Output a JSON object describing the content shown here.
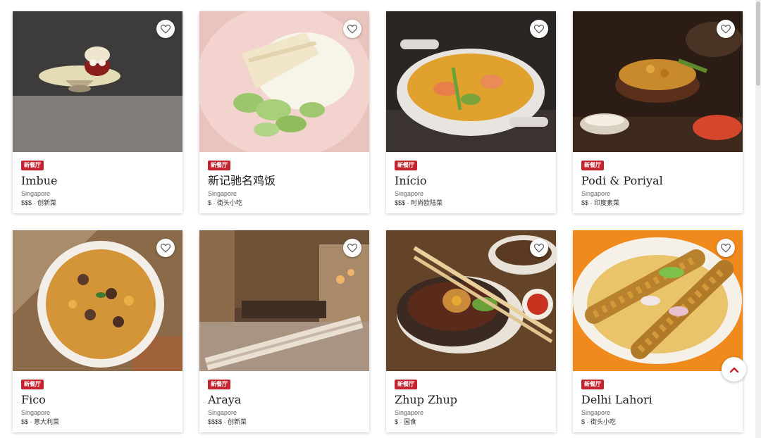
{
  "badge_label": "新餐厅",
  "cards": [
    {
      "name": "Imbue",
      "location": "Singapore",
      "meta": "$$$ · 创新菜",
      "image": "dessert-plate"
    },
    {
      "name": "新记驰名鸡饭",
      "location": "Singapore",
      "meta": "$ · 街头小吃",
      "image": "chicken-rice"
    },
    {
      "name": "Início",
      "location": "Singapore",
      "meta": "$$$ · 时尚欧陆菜",
      "image": "curry-casserole"
    },
    {
      "name": "Podi & Poriyal",
      "location": "Singapore",
      "meta": "$$ · 印度素菜",
      "image": "indian-bowls"
    },
    {
      "name": "Fico",
      "location": "Singapore",
      "meta": "$$ · 意大利菜",
      "image": "tomato-dish"
    },
    {
      "name": "Araya",
      "location": "Singapore",
      "meta": "$$$$ · 创新菜",
      "image": "dining-room"
    },
    {
      "name": "Zhup Zhup",
      "location": "Singapore",
      "meta": "$ · 国食",
      "image": "claypot-chopsticks"
    },
    {
      "name": "Delhi Lahori",
      "location": "Singapore",
      "meta": "$ · 街头小吃",
      "image": "kebab-orange"
    }
  ],
  "icons": {
    "favorite": "heart-outline-icon",
    "gallery": "photo-gallery-icon",
    "back_to_top": "chevron-up-icon"
  },
  "colors": {
    "badge": "#c4242f",
    "accent": "#c4242f"
  }
}
